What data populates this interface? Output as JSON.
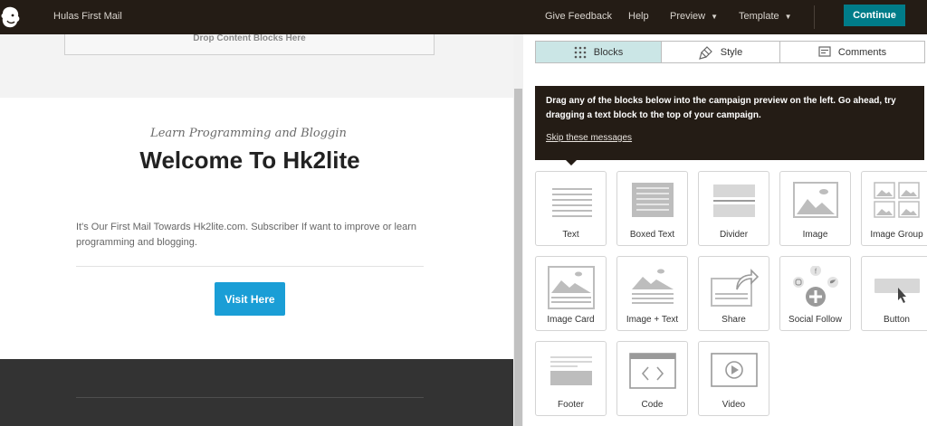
{
  "header": {
    "campaign_name": "Hulas First Mail",
    "nav": {
      "give_feedback": "Give Feedback",
      "help": "Help",
      "preview": "Preview",
      "template": "Template"
    },
    "continue_label": "Continue",
    "accent_color": "#007c89"
  },
  "preview": {
    "dropzone_text": "Drop Content Blocks Here",
    "subtitle": "Learn Programming and Bloggin",
    "headline": "Welcome To Hk2lite",
    "body": "It's Our First Mail Towards Hk2lite.com. Subscriber If want to improve or learn programming and blogging.",
    "button_label": "Visit Here",
    "button_color": "#1a9ed6"
  },
  "panel": {
    "tabs": [
      {
        "label": "Blocks",
        "icon": "grid-icon",
        "active": true
      },
      {
        "label": "Style",
        "icon": "paintbrush-icon",
        "active": false
      },
      {
        "label": "Comments",
        "icon": "comment-icon",
        "active": false
      }
    ],
    "tip": {
      "message": "Drag any of the blocks below into the campaign preview on the left. Go ahead, try dragging a text block to the top of your campaign.",
      "skip_label": "Skip these messages"
    },
    "blocks": [
      {
        "label": "Text",
        "icon": "text-block-icon"
      },
      {
        "label": "Boxed Text",
        "icon": "boxed-text-icon"
      },
      {
        "label": "Divider",
        "icon": "divider-icon"
      },
      {
        "label": "Image",
        "icon": "image-icon"
      },
      {
        "label": "Image Group",
        "icon": "image-group-icon"
      },
      {
        "label": "Image Card",
        "icon": "image-card-icon"
      },
      {
        "label": "Image + Text",
        "icon": "image-text-icon"
      },
      {
        "label": "Share",
        "icon": "share-icon"
      },
      {
        "label": "Social Follow",
        "icon": "social-follow-icon"
      },
      {
        "label": "Button",
        "icon": "button-block-icon"
      },
      {
        "label": "Footer",
        "icon": "footer-icon"
      },
      {
        "label": "Code",
        "icon": "code-icon"
      },
      {
        "label": "Video",
        "icon": "video-icon"
      }
    ]
  }
}
